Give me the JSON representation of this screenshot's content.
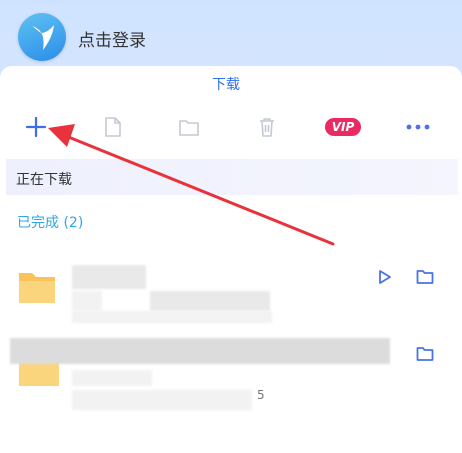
{
  "header": {
    "login_label": "点击登录"
  },
  "panel": {
    "title": "下载"
  },
  "toolbar": {
    "vip_label": "VIP",
    "icons": [
      "add-icon",
      "file-icon",
      "folder-icon",
      "trash-icon",
      "vip-badge",
      "more-icon"
    ]
  },
  "tabs": {
    "downloading_label": "正在下载",
    "completed_label": "已完成 (2)"
  },
  "files": [
    {
      "name": "",
      "actions": [
        "play-icon",
        "open-folder-icon"
      ]
    },
    {
      "name": "",
      "meta_fragment": "5",
      "actions": [
        "open-folder-icon"
      ]
    }
  ],
  "colors": {
    "accent": "#2d6ff0",
    "completed": "#2ea5e6",
    "vip": "#ea2a63",
    "annotation_arrow": "#e8323c",
    "folder": "#f9c25a"
  }
}
